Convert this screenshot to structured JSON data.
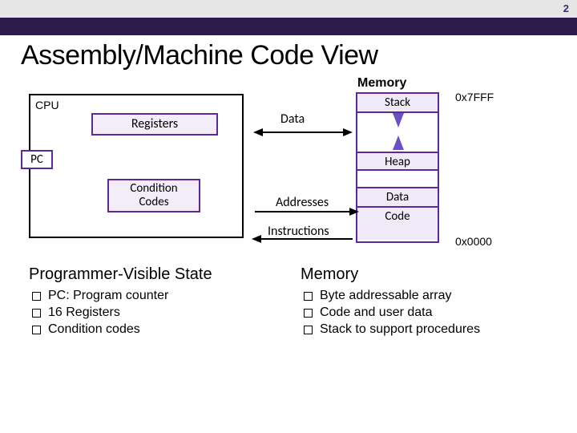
{
  "page_number": "2",
  "title": "Assembly/Machine Code View",
  "memory_title": "Memory",
  "cpu": {
    "label": "CPU",
    "registers": "Registers",
    "pc": "PC",
    "condition_codes": "Condition\nCodes"
  },
  "memory_column": {
    "stack": "Stack",
    "heap": "Heap",
    "data": "Data",
    "code": "Code",
    "addr_high": "0x7FFF",
    "addr_low": "0x0000"
  },
  "labels": {
    "data": "Data",
    "addresses": "Addresses",
    "instructions": "Instructions"
  },
  "left_section": {
    "heading": "Programmer-Visible State",
    "items": [
      {
        "pre": "PC: ",
        "text": "Program counter"
      },
      {
        "pre": "16 ",
        "text": "Registers"
      },
      {
        "pre": "Condition ",
        "text": "codes"
      }
    ]
  },
  "right_section": {
    "heading": "Memory",
    "items": [
      "Byte addressable array",
      "Code and user data",
      "Stack to support procedures"
    ]
  }
}
